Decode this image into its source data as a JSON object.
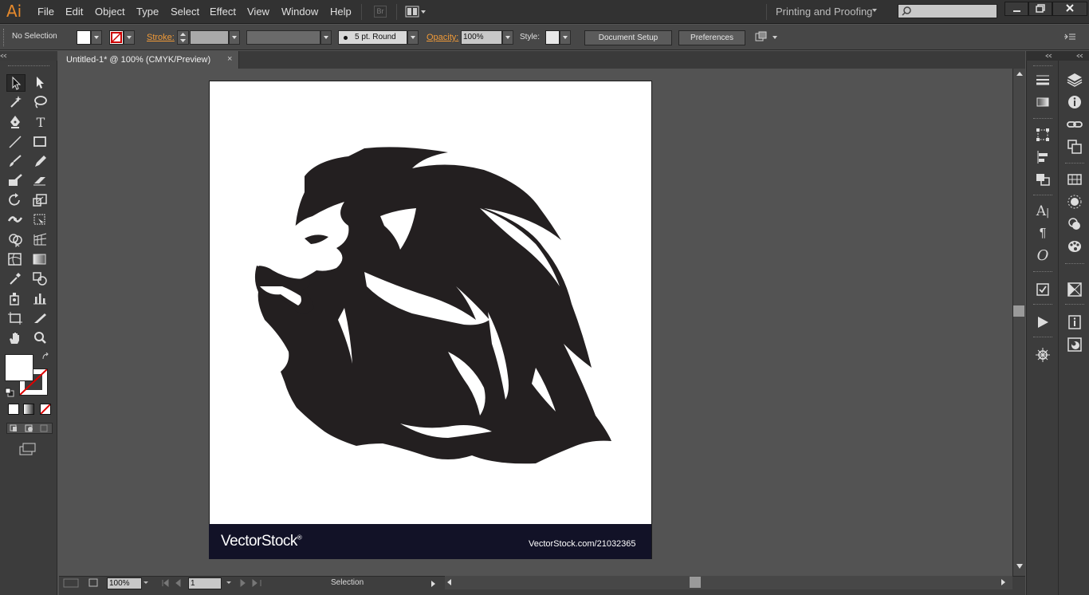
{
  "app": {
    "logo": "Ai"
  },
  "menu": [
    "File",
    "Edit",
    "Object",
    "Type",
    "Select",
    "Effect",
    "View",
    "Window",
    "Help"
  ],
  "bridge_label": "Br",
  "workspace": "Printing and Proofing",
  "control": {
    "selection": "No Selection",
    "stroke_label": "Stroke:",
    "brush": "5 pt. Round",
    "opacity_label": "Opacity:",
    "opacity": "100%",
    "style_label": "Style:",
    "document_setup": "Document Setup",
    "preferences": "Preferences"
  },
  "document": {
    "tab_title": "Untitled-1* @ 100% (CMYK/Preview)",
    "close": "×"
  },
  "artwork": {
    "brand": "VectorStock",
    "registered": "®",
    "url": "VectorStock.com/21032365",
    "colors": {
      "ink": "#231f20",
      "banner": "#121227"
    }
  },
  "status": {
    "zoom": "100%",
    "page": "1",
    "mode": "Selection"
  },
  "colors": {
    "accent": "#f09a38",
    "chrome": "#323232",
    "pasteboard": "#535353"
  }
}
